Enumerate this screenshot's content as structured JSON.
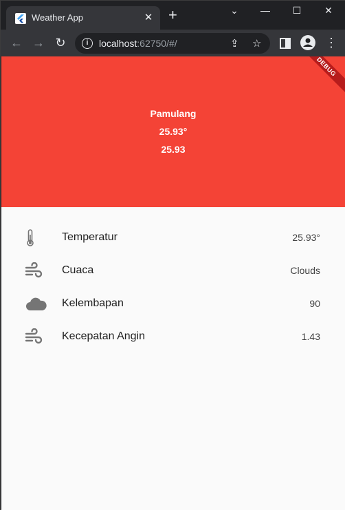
{
  "browser": {
    "tab_title": "Weather App",
    "tab_close": "✕",
    "new_tab": "+",
    "url_host": "localhost",
    "url_rest": ":62750/#/"
  },
  "header": {
    "city": "Pamulang",
    "temp_deg": "25.93°",
    "temp_raw": "25.93",
    "debug_banner": "DEBUG",
    "color": "#f44336"
  },
  "rows": [
    {
      "icon": "thermometer-icon",
      "label": "Temperatur",
      "value": "25.93°"
    },
    {
      "icon": "wind-icon",
      "label": "Cuaca",
      "value": "Clouds"
    },
    {
      "icon": "cloud-icon",
      "label": "Kelembapan",
      "value": "90"
    },
    {
      "icon": "wind-icon",
      "label": "Kecepatan Angin",
      "value": "1.43"
    }
  ]
}
